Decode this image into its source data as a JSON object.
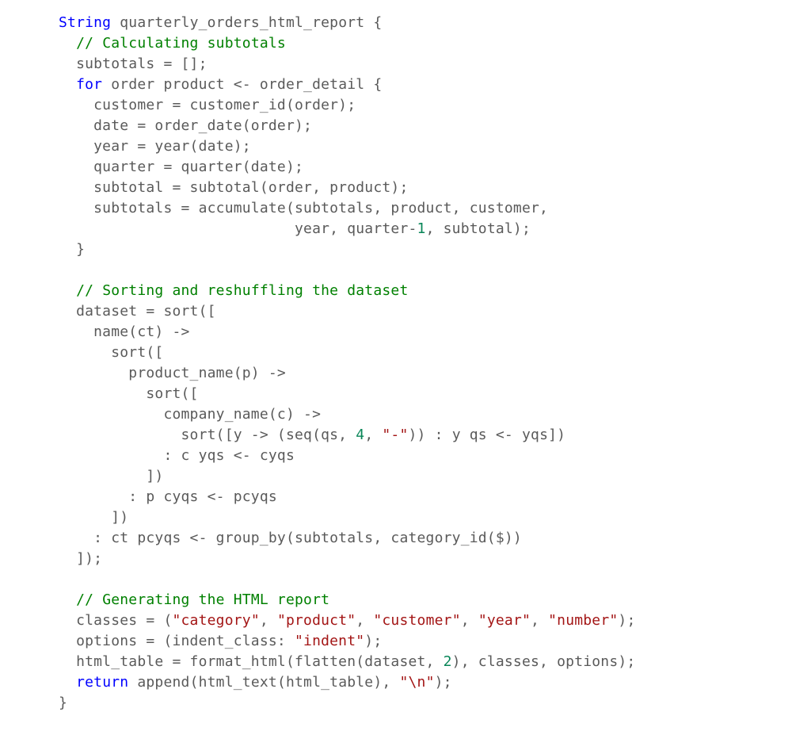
{
  "code": {
    "tokens": [
      {
        "cls": "kw",
        "t": "String"
      },
      {
        "t": " quarterly_orders_html_report {\n  "
      },
      {
        "cls": "cm",
        "t": "// Calculating subtotals"
      },
      {
        "t": "\n  subtotals = [];\n  "
      },
      {
        "cls": "kw",
        "t": "for"
      },
      {
        "t": " order product <- order_detail {\n    customer = customer_id(order);\n    date = order_date(order);\n    year = year(date);\n    quarter = quarter(date);\n    subtotal = subtotal(order, product);\n    subtotals = accumulate(subtotals, product, customer,\n                           year, quarter-"
      },
      {
        "cls": "nm",
        "t": "1"
      },
      {
        "t": ", subtotal);\n  }\n\n  "
      },
      {
        "cls": "cm",
        "t": "// Sorting and reshuffling the dataset"
      },
      {
        "t": "\n  dataset = sort([\n    name(ct) ->\n      sort([\n        product_name(p) ->\n          sort([\n            company_name(c) ->\n              sort([y -> (seq(qs, "
      },
      {
        "cls": "nm",
        "t": "4"
      },
      {
        "t": ", "
      },
      {
        "cls": "st",
        "t": "\"-\""
      },
      {
        "t": ")) : y qs <- yqs])\n            : c yqs <- cyqs\n          ])\n        : p cyqs <- pcyqs\n      ])\n    : ct pcyqs <- group_by(subtotals, category_id($))\n  ]);\n\n  "
      },
      {
        "cls": "cm",
        "t": "// Generating the HTML report"
      },
      {
        "t": "\n  classes = ("
      },
      {
        "cls": "st",
        "t": "\"category\""
      },
      {
        "t": ", "
      },
      {
        "cls": "st",
        "t": "\"product\""
      },
      {
        "t": ", "
      },
      {
        "cls": "st",
        "t": "\"customer\""
      },
      {
        "t": ", "
      },
      {
        "cls": "st",
        "t": "\"year\""
      },
      {
        "t": ", "
      },
      {
        "cls": "st",
        "t": "\"number\""
      },
      {
        "t": ");\n  options = (indent_class: "
      },
      {
        "cls": "st",
        "t": "\"indent\""
      },
      {
        "t": ");\n  html_table = format_html(flatten(dataset, "
      },
      {
        "cls": "nm",
        "t": "2"
      },
      {
        "t": "), classes, options);\n  "
      },
      {
        "cls": "kw",
        "t": "return"
      },
      {
        "t": " append(html_text(html_table), "
      },
      {
        "cls": "st",
        "t": "\"\\n\""
      },
      {
        "t": ");\n}"
      }
    ]
  }
}
